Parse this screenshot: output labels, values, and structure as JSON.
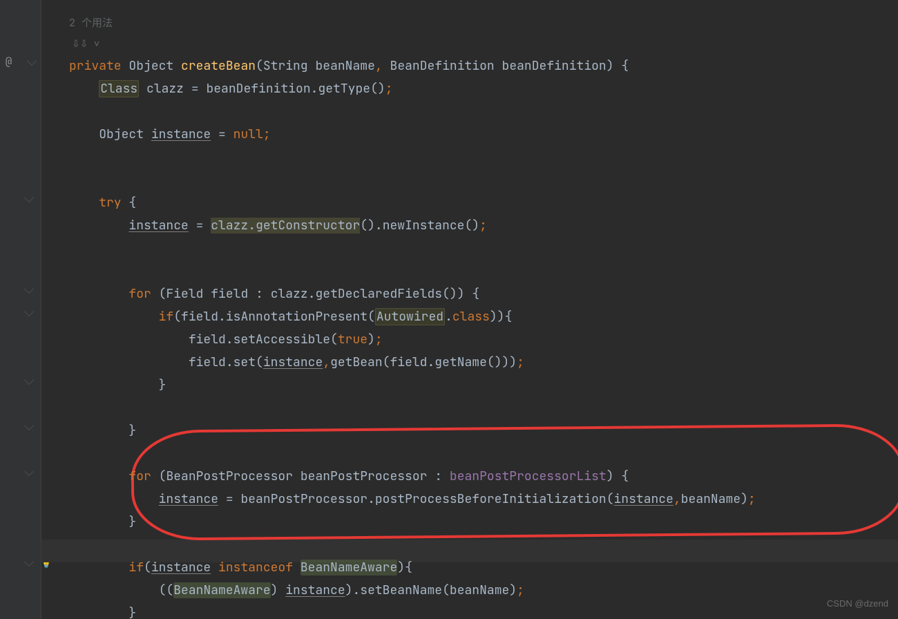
{
  "hints": {
    "usages": "2 个用法",
    "inherit_arrow": "⇩⇩ ˅"
  },
  "gutter": {
    "annotation_icon": "@",
    "bulb": "💡"
  },
  "tokens": {
    "private": "private",
    "object": "Object",
    "createBean": "createBean",
    "string": "String",
    "beanName": "beanName",
    "beanDefinition_type": "BeanDefinition",
    "beanDefinition": "beanDefinition",
    "class": "Class",
    "clazz": "clazz",
    "getType": "getType",
    "instance": "instance",
    "null": "null",
    "try": "try",
    "getConstructor": "getConstructor",
    "newInstance": "newInstance",
    "for": "for",
    "field_t": "Field",
    "field": "field",
    "getDeclaredFields": "getDeclaredFields",
    "if": "if",
    "isAnnotationPresent": "isAnnotationPresent",
    "autowired": "Autowired",
    "class_lit": "class",
    "setAccessible": "setAccessible",
    "true": "true",
    "set": "set",
    "getBean": "getBean",
    "getName": "getName",
    "bpp_t": "BeanPostProcessor",
    "bpp": "beanPostProcessor",
    "bpp_list": "beanPostProcessorList",
    "ppb": "postProcessBeforeInitialization",
    "instanceof": "instanceof",
    "bna": "BeanNameAware",
    "setBeanName": "setBeanName"
  },
  "watermark": "CSDN @dzend"
}
